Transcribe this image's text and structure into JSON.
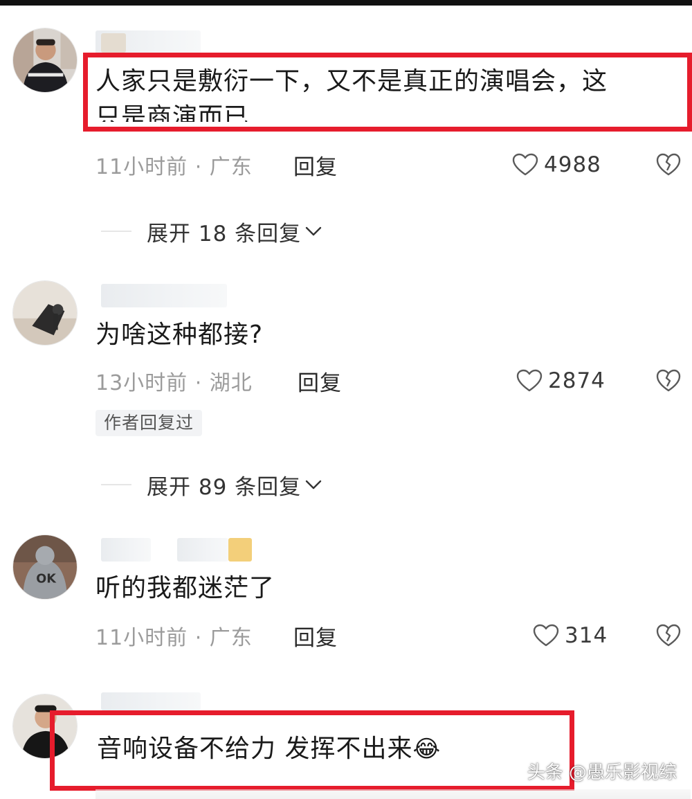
{
  "comments": [
    {
      "text": "人家只是敷衍一下，又不是真正的演唱会，这",
      "text_cut": "只是商演而已",
      "time": "11小时前",
      "location": "广东",
      "reply_label": "回复",
      "likes": "4988",
      "expand_label": "展开 18 条回复"
    },
    {
      "text": "为啥这种都接?",
      "time": "13小时前",
      "location": "湖北",
      "reply_label": "回复",
      "likes": "2874",
      "badge": "作者回复过",
      "expand_label": "展开 89 条回复"
    },
    {
      "text": "听的我都迷茫了",
      "time": "11小时前",
      "location": "广东",
      "reply_label": "回复",
      "likes": "314"
    },
    {
      "text": "音响设备不给力 发挥不出来",
      "emoji": "😂"
    }
  ],
  "meta_separator": " · ",
  "watermark": "头条 @愚乐影视综",
  "colors": {
    "highlight": "#e61c2c",
    "meta_gray": "#9b9b9b",
    "text": "#1a1a1a"
  },
  "icons": [
    "heart-outline-icon",
    "broken-heart-icon",
    "chevron-down-icon",
    "laughing-tears-emoji"
  ]
}
